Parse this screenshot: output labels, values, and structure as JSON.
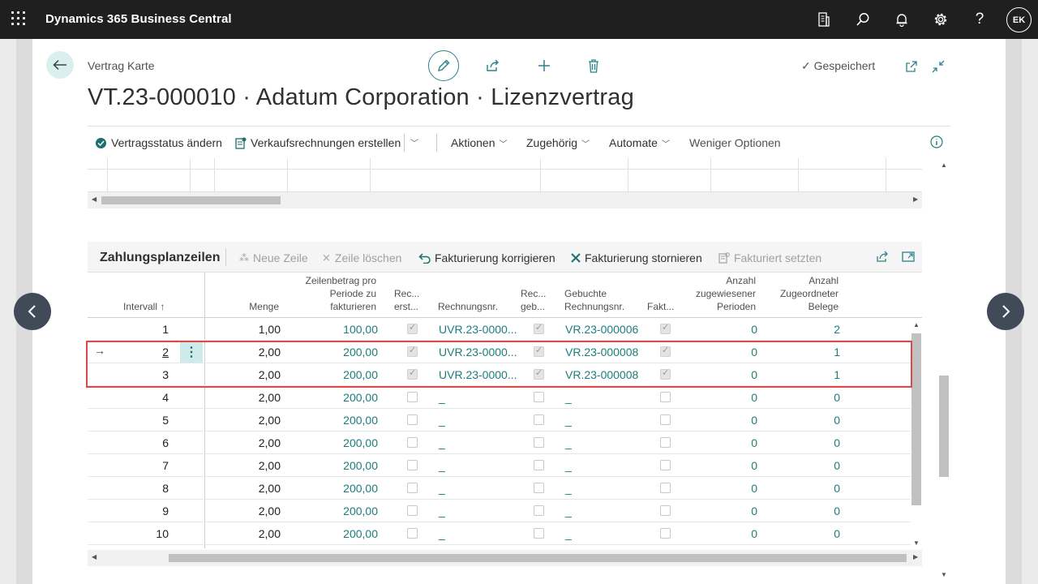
{
  "app": {
    "title": "Dynamics 365 Business Central",
    "avatar_initials": "EK"
  },
  "topbar_icons": [
    "document-icon",
    "search-icon",
    "bell-icon",
    "gear-icon",
    "help-icon"
  ],
  "page": {
    "breadcrumb": "Vertrag Karte",
    "title": "VT.23-000010 · Adatum Corporation · Lizenzvertrag",
    "saved_status": "Gespeichert"
  },
  "actions": {
    "status": "Vertragsstatus ändern",
    "invoices": "Verkaufsrechnungen erstellen",
    "aktionen": "Aktionen",
    "zugehoerig": "Zugehörig",
    "automate": "Automate",
    "weniger": "Weniger Optionen"
  },
  "subpage": {
    "title": "Zahlungsplanzeilen",
    "actions": {
      "neue_zeile": "Neue Zeile",
      "zeile_loeschen": "Zeile löschen",
      "korrigieren": "Fakturierung korrigieren",
      "stornieren": "Fakturierung stornieren",
      "fakturiert_setzen": "Fakturiert setzten"
    },
    "columns": {
      "intervall": "Intervall ↑",
      "menge": "Menge",
      "zeilenbetrag_1": "Zeilenbetrag pro",
      "zeilenbetrag_2": "Periode zu",
      "zeilenbetrag_3": "fakturieren",
      "rec_erst_1": "Rec...",
      "rec_erst_2": "erst...",
      "rechnungsnr": "Rechnungsnr.",
      "rec_geb_1": "Rec...",
      "rec_geb_2": "geb...",
      "gebuchte_1": "Gebuchte",
      "gebuchte_2": "Rechnungsnr.",
      "fakt": "Fakt...",
      "anz_per_1": "Anzahl",
      "anz_per_2": "zugewiesener",
      "anz_per_3": "Perioden",
      "anz_bel_1": "Anzahl",
      "anz_bel_2": "Zugeordneter",
      "anz_bel_3": "Belege"
    },
    "rows": [
      {
        "intervall": "1",
        "menge": "1,00",
        "betrag": "100,00",
        "rec_erst": true,
        "rechnungsnr": "UVR.23-0000...",
        "rec_geb": true,
        "gebuchte": "VR.23-000006",
        "fakt": true,
        "perioden": "0",
        "belege": "2"
      },
      {
        "intervall": "2",
        "menge": "2,00",
        "betrag": "200,00",
        "rec_erst": true,
        "rechnungsnr": "UVR.23-0000...",
        "rec_geb": true,
        "gebuchte": "VR.23-000008",
        "fakt": true,
        "perioden": "0",
        "belege": "1"
      },
      {
        "intervall": "3",
        "menge": "2,00",
        "betrag": "200,00",
        "rec_erst": true,
        "rechnungsnr": "UVR.23-0000...",
        "rec_geb": true,
        "gebuchte": "VR.23-000008",
        "fakt": true,
        "perioden": "0",
        "belege": "1"
      },
      {
        "intervall": "4",
        "menge": "2,00",
        "betrag": "200,00",
        "rec_erst": false,
        "rechnungsnr": "_",
        "rec_geb": false,
        "gebuchte": "_",
        "fakt": false,
        "perioden": "0",
        "belege": "0"
      },
      {
        "intervall": "5",
        "menge": "2,00",
        "betrag": "200,00",
        "rec_erst": false,
        "rechnungsnr": "_",
        "rec_geb": false,
        "gebuchte": "_",
        "fakt": false,
        "perioden": "0",
        "belege": "0"
      },
      {
        "intervall": "6",
        "menge": "2,00",
        "betrag": "200,00",
        "rec_erst": false,
        "rechnungsnr": "_",
        "rec_geb": false,
        "gebuchte": "_",
        "fakt": false,
        "perioden": "0",
        "belege": "0"
      },
      {
        "intervall": "7",
        "menge": "2,00",
        "betrag": "200,00",
        "rec_erst": false,
        "rechnungsnr": "_",
        "rec_geb": false,
        "gebuchte": "_",
        "fakt": false,
        "perioden": "0",
        "belege": "0"
      },
      {
        "intervall": "8",
        "menge": "2,00",
        "betrag": "200,00",
        "rec_erst": false,
        "rechnungsnr": "_",
        "rec_geb": false,
        "gebuchte": "_",
        "fakt": false,
        "perioden": "0",
        "belege": "0"
      },
      {
        "intervall": "9",
        "menge": "2,00",
        "betrag": "200,00",
        "rec_erst": false,
        "rechnungsnr": "_",
        "rec_geb": false,
        "gebuchte": "_",
        "fakt": false,
        "perioden": "0",
        "belege": "0"
      },
      {
        "intervall": "10",
        "menge": "2,00",
        "betrag": "200,00",
        "rec_erst": false,
        "rechnungsnr": "_",
        "rec_geb": false,
        "gebuchte": "_",
        "fakt": false,
        "perioden": "0",
        "belege": "0"
      }
    ],
    "selected_row": 2,
    "highlighted_rows": [
      2,
      3
    ]
  },
  "colors": {
    "topbar": "#1f1f1f",
    "accent": "#1b7d7d",
    "highlight": "#e04848",
    "nav": "#404b5a"
  }
}
